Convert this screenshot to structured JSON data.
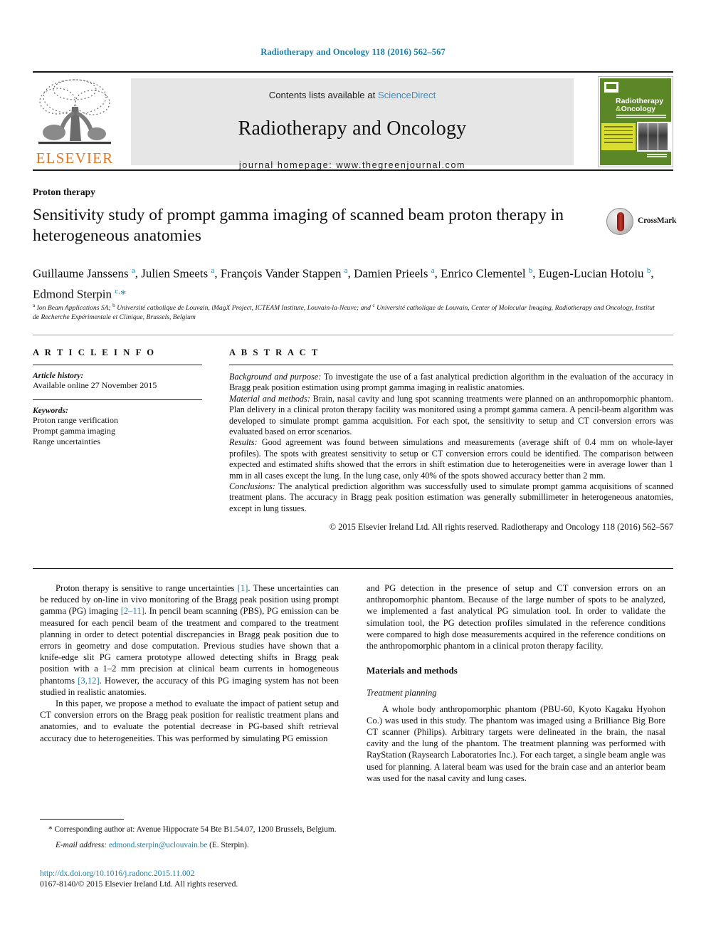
{
  "running_head": "Radiotherapy and Oncology 118 (2016) 562–567",
  "masthead": {
    "publisher_logo_label": "ELSEVIER",
    "contents_prefix": "Contents lists available at",
    "contents_link": "ScienceDirect",
    "journal_title": "Radiotherapy and Oncology",
    "homepage": "journal homepage: www.thegreenjournal.com",
    "cover": {
      "title_line1": "Radiotherapy",
      "title_amp": "&",
      "title_line2": "Oncology"
    }
  },
  "article": {
    "section_label": "Proton therapy",
    "title": "Sensitivity study of prompt gamma imaging of scanned beam proton therapy in heterogeneous anatomies",
    "crossmark_label": "CrossMark",
    "authors_html": "Guillaume Janssens <sup>a</sup>, Julien Smeets <sup>a</sup>, François Vander Stappen <sup>a</sup>, Damien Prieels <sup>a</sup>, Enrico Clementel <sup>b</sup>, Eugen-Lucian Hotoiu <sup>b</sup>, Edmond Sterpin <sup>c,</sup><span class=\"star\">*</span>",
    "affiliations_html": "<sup>a</sup> Ion Beam Applications SA; <sup>b</sup> Université catholique de Louvain, iMagX Project, ICTEAM Institute, Louvain-la-Neuve; and <sup>c</sup> Université catholique de Louvain, Center of Molecular Imaging, Radiotherapy and Oncology, Institut de Recherche Expérimentale et Clinique, Brussels, Belgium"
  },
  "info": {
    "heading": "A R T I C L E  I N F O",
    "history_label": "Article history:",
    "history_value": "Available online 27 November 2015",
    "keywords_label": "Keywords:",
    "keywords": [
      "Proton range verification",
      "Prompt gamma imaging",
      "Range uncertainties"
    ]
  },
  "abstract": {
    "heading": "A B S T R A C T",
    "background_label": "Background and purpose:",
    "background_text": " To investigate the use of a fast analytical prediction algorithm in the evaluation of the accuracy in Bragg peak position estimation using prompt gamma imaging in realistic anatomies.",
    "methods_label": "Material and methods:",
    "methods_text": " Brain, nasal cavity and lung spot scanning treatments were planned on an anthropomorphic phantom. Plan delivery in a clinical proton therapy facility was monitored using a prompt gamma camera. A pencil-beam algorithm was developed to simulate prompt gamma acquisition. For each spot, the sensitivity to setup and CT conversion errors was evaluated based on error scenarios.",
    "results_label": "Results:",
    "results_text": " Good agreement was found between simulations and measurements (average shift of 0.4 mm on whole-layer profiles). The spots with greatest sensitivity to setup or CT conversion errors could be identified. The comparison between expected and estimated shifts showed that the errors in shift estimation due to heterogeneities were in average lower than 1 mm in all cases except the lung. In the lung case, only 40% of the spots showed accuracy better than 2 mm.",
    "conclusions_label": "Conclusions:",
    "conclusions_text": " The analytical prediction algorithm was successfully used to simulate prompt gamma acquisitions of scanned treatment plans. The accuracy in Bragg peak position estimation was generally submillimeter in heterogeneous anatomies, except in lung tissues.",
    "copyright": "© 2015 Elsevier Ireland Ltd. All rights reserved. Radiotherapy and Oncology 118 (2016) 562–567"
  },
  "body": {
    "left": {
      "para1_html": "Proton therapy is sensitive to range uncertainties <span class=\"ref\">[1]</span>. These uncertainties can be reduced by on-line in vivo monitoring of the Bragg peak position using prompt gamma (PG) imaging <span class=\"ref\">[2–11]</span>. In pencil beam scanning (PBS), PG emission can be measured for each pencil beam of the treatment and compared to the treatment planning in order to detect potential discrepancies in Bragg peak position due to errors in geometry and dose computation. Previous studies have shown that a knife-edge slit PG camera prototype allowed detecting shifts in Bragg peak position with a 1–2 mm precision at clinical beam currents in homogeneous phantoms <span class=\"ref\">[3,12]</span>. However, the accuracy of this PG imaging system has not been studied in realistic anatomies.",
      "para2_html": "In this paper, we propose a method to evaluate the impact of patient setup and CT conversion errors on the Bragg peak position for realistic treatment plans and anatomies, and to evaluate the potential decrease in PG-based shift retrieval accuracy due to heterogeneities. This was performed by simulating PG emission"
    },
    "right": {
      "para1_html": "and PG detection in the presence of setup and CT conversion errors on an anthropomorphic phantom. Because of the large number of spots to be analyzed, we implemented a fast analytical PG simulation tool. In order to validate the simulation tool, the PG detection profiles simulated in the reference conditions were compared to high dose measurements acquired in the reference conditions on the anthropomorphic phantom in a clinical proton therapy facility.",
      "section_heading": "Materials and methods",
      "subsection_heading": "Treatment planning",
      "para2_html": "A whole body anthropomorphic phantom (PBU-60, Kyoto Kagaku Hyohon Co.) was used in this study. The phantom was imaged using a Brilliance Big Bore CT scanner (Philips). Arbitrary targets were delineated in the brain, the nasal cavity and the lung of the phantom. The treatment planning was performed with RayStation (Raysearch Laboratories Inc.). For each target, a single beam angle was used for planning. A lateral beam was used for the brain case and an anterior beam was used for the nasal cavity and lung cases."
    }
  },
  "footnotes": {
    "corresponding_html": "* Corresponding author at: Avenue Hippocrate 54 Bte B1.54.07, 1200 Brussels, Belgium.",
    "email_label": "E-mail address:",
    "email_value": "edmond.sterpin@uclouvain.be",
    "email_suffix": " (E. Sterpin)."
  },
  "imprint": {
    "doi": "http://dx.doi.org/10.1016/j.radonc.2015.11.002",
    "issn_line": "0167-8140/© 2015 Elsevier Ireland Ltd. All rights reserved."
  },
  "colors": {
    "link_blue": "#1a7fa8",
    "science_direct_blue": "#3b8fc4",
    "elsevier_orange": "#E87722",
    "cover_green": "#5c8727",
    "cover_yellow": "#d8dd2e",
    "band_gray": "#e6e6e6"
  }
}
